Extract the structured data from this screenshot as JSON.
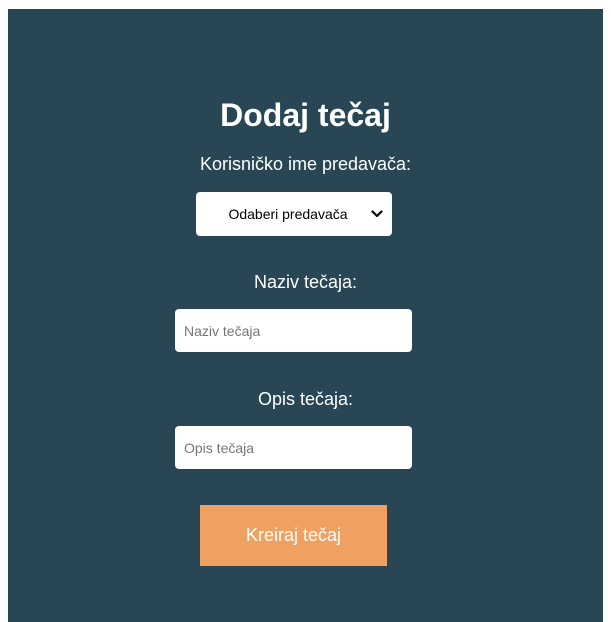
{
  "form": {
    "title": "Dodaj tečaj",
    "instructor_label": "Korisničko ime predavača:",
    "instructor_select_value": "Odaberi predavača",
    "course_name_label": "Naziv tečaja:",
    "course_name_placeholder": "Naziv tečaja",
    "course_desc_label": "Opis tečaja:",
    "course_desc_placeholder": "Opis tečaja",
    "submit_label": "Kreiraj tečaj"
  },
  "colors": {
    "panel_background": "#284653",
    "button_background": "#f0a060",
    "text": "#ffffff"
  },
  "icons": {
    "select_arrow": "chevron-down-icon"
  }
}
